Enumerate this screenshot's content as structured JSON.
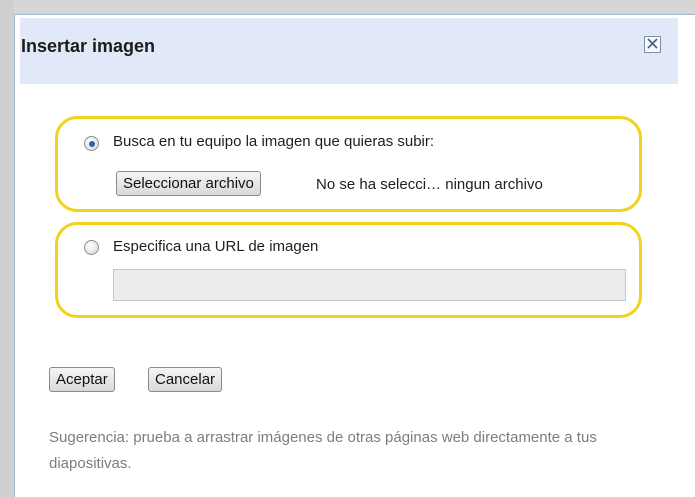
{
  "dialog": {
    "title": "Insertar imagen",
    "close_icon": "close-icon"
  },
  "upload_option": {
    "label": "Busca en tu equipo la imagen que quieras subir:",
    "checked": true,
    "file_button_label": "Seleccionar archivo",
    "file_status": "No se ha selecci… ningun archivo"
  },
  "url_option": {
    "label": "Especifica una URL de imagen",
    "checked": false,
    "value": "",
    "placeholder": ""
  },
  "actions": {
    "accept_label": "Aceptar",
    "cancel_label": "Cancelar"
  },
  "hint": "Sugerencia: prueba a arrastrar imágenes de otras páginas web directamente a tus diapositivas.",
  "colors": {
    "header_bg": "#e1e9f8",
    "highlight_ring": "#f2d21a",
    "hint_text": "#7d7d7d"
  }
}
